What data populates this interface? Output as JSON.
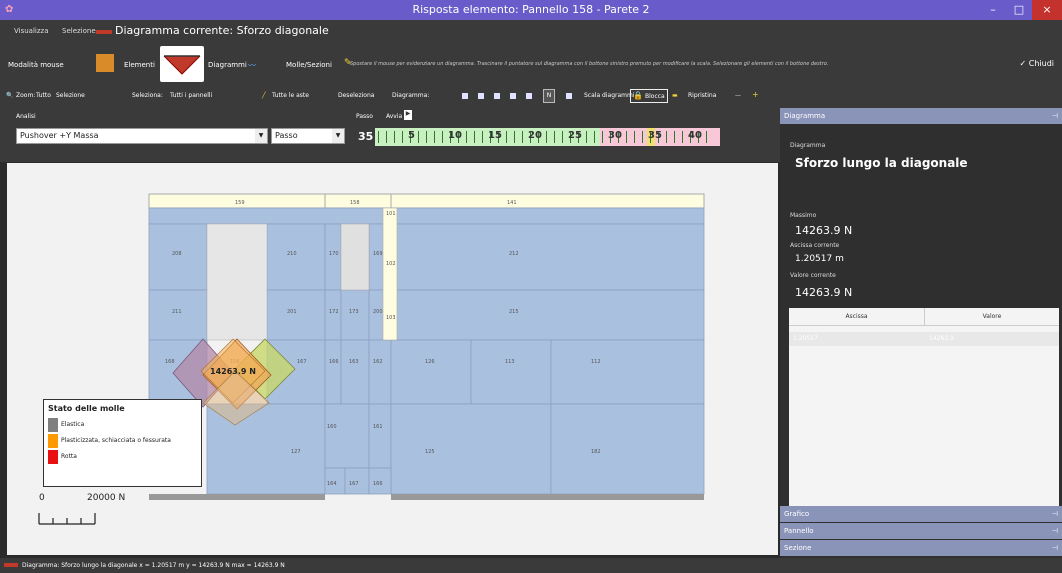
{
  "window": {
    "title": "Risposta elemento: Pannello 158 - Parete 2",
    "min": "–",
    "max": "□",
    "close": "×"
  },
  "toolbar_row1": {
    "menu_visualizza": "Visualizza",
    "menu_selezione": "Selezione",
    "diagram_title": "Diagramma corrente: Sforzo diagonale"
  },
  "toolbar_row2": {
    "mouse_mode": "Modalità mouse",
    "elementi": "Elementi",
    "diagrammi": "Diagrammi",
    "molle": "Molle/Sezioni",
    "instructions": "Spostare il mouse per evidenziare un diagramma. Trascinare il puntatore sul diagramma con il bottone sinistro premuto per modificare la scala. Selezionare gli elementi con il bottone destro.",
    "chiudi": "Chiudi"
  },
  "toolbar_row3": {
    "zoom": "Zoom:",
    "tutto": "Tutto",
    "selezione": "Selezione",
    "seleziona": "Seleziona:",
    "tutti_pannelli": "Tutti i pannelli",
    "tutte_aste": "Tutte le aste",
    "deseleziona": "Deseleziona",
    "diagramma": "Diagramma:",
    "n_label": "N",
    "scala_diagrammi": "Scala diagrammi",
    "blocca": "Blocca",
    "ripristina": "Ripristina"
  },
  "analysis": {
    "label": "Analisi",
    "value": "Pushover +Y Massa",
    "passo_label": "Passo",
    "avvia_label": "Avvia",
    "passo_combo": "Passo",
    "step": "35",
    "timeline_ticks": [
      "5",
      "10",
      "15",
      "20",
      "25",
      "30",
      "35",
      "40"
    ],
    "colors": {
      "green": "#c8f0c0",
      "pink": "#f8c8d8",
      "yellow": "#f0e070"
    }
  },
  "structure": {
    "top_labels": [
      "159",
      "158",
      "141"
    ],
    "panels": [
      "208",
      "210",
      "170",
      "169",
      "101",
      "102",
      "212",
      "211",
      "201",
      "172",
      "173",
      "200",
      "103",
      "215",
      "168",
      "158",
      "167",
      "166",
      "163",
      "162",
      "126",
      "113",
      "112",
      "160",
      "161",
      "127",
      "125",
      "182",
      "164",
      "167",
      "166"
    ],
    "value_label": "14263.9 N"
  },
  "legend": {
    "title": "Stato delle molle",
    "items": [
      {
        "label": "Elastica",
        "color": "#7f7f7f"
      },
      {
        "label": "Plasticizzata, schiacciata o fessurata",
        "color": "#ff9900"
      },
      {
        "label": "Rotta",
        "color": "#e81010"
      }
    ]
  },
  "scale": {
    "zero": "0",
    "value": "20000 N"
  },
  "panel": {
    "header": "Diagramma",
    "diag_label": "Diagramma",
    "diag_title": "Sforzo lungo la diagonale",
    "max_label": "Massimo",
    "max_value": "14263.9 N",
    "absc_label": "Ascissa corrente",
    "absc_value": "1.20517 m",
    "curr_label": "Valore corrente",
    "curr_value": "14263.9 N",
    "table_col1": "Ascissa",
    "table_col2": "Valore",
    "row_a": "1.20517",
    "row_b": "14263.9"
  },
  "sections": {
    "grafico": "Grafico",
    "pannello": "Pannello",
    "sezione": "Sezione"
  },
  "status": {
    "text": "Diagramma: Sforzo lungo la diagonale  x = 1.20517 m  y = 14263.9 N  max = 14263.9 N"
  }
}
